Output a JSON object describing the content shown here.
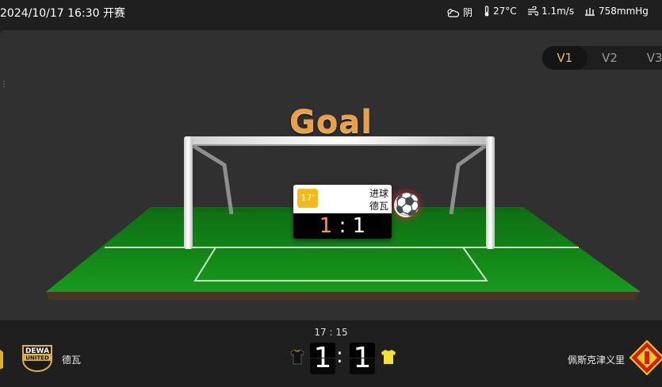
{
  "topbar": {
    "datetime": "2024/10/17 16:30 开赛",
    "weather": {
      "condition": "阴",
      "temperature": "27°C",
      "wind": "1.1m/s",
      "pressure": "758mmHg"
    }
  },
  "view_tabs": [
    "V1",
    "V2",
    "V3"
  ],
  "active_view": "V1",
  "event": {
    "title": "Goal",
    "minute": "17'",
    "type": "进球",
    "team": "德瓦",
    "score_home": "1",
    "score_away": "1",
    "score_sep": ":"
  },
  "match": {
    "clock": "17 : 15",
    "home": {
      "name": "德瓦",
      "logo_text_top": "DEWA",
      "logo_text_bottom": "UNITED",
      "shirt_color": "#111111"
    },
    "away": {
      "name": "佩斯克津义里",
      "shirt_color": "#f5e03a"
    },
    "score_home": "1",
    "score_away": "1",
    "score_sep": ":"
  },
  "icons": [
    "cloud-sun-icon",
    "thermometer-icon",
    "wind-icon",
    "pressure-icon",
    "soccer-ball-icon",
    "shirt-icon"
  ]
}
